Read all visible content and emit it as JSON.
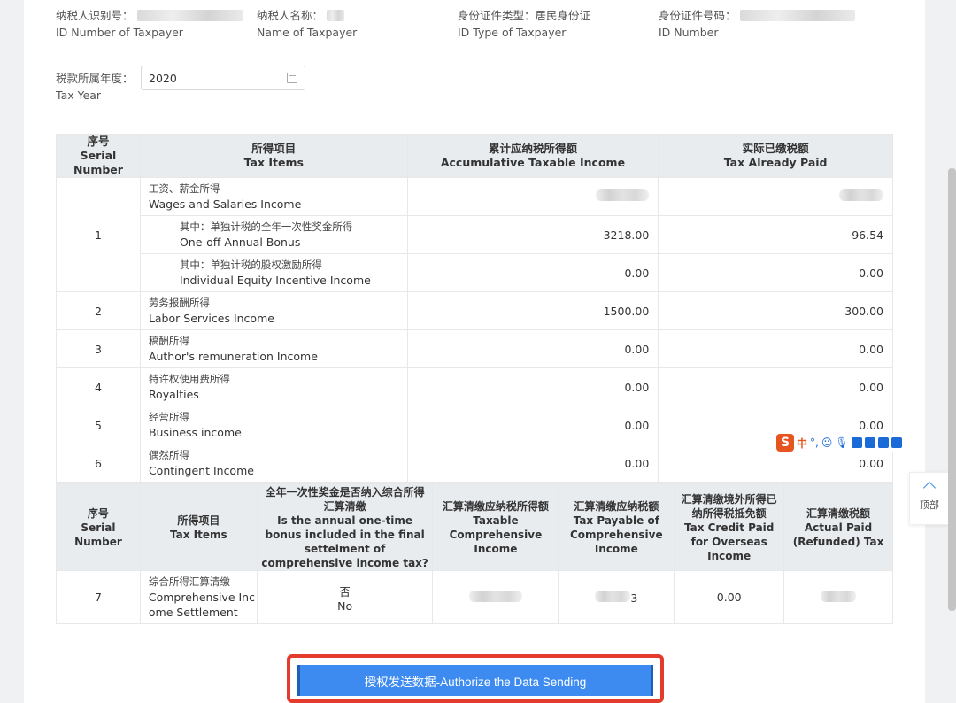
{
  "header": {
    "taxpayer_id_cn": "纳税人识别号：",
    "taxpayer_id_en": "ID Number of Taxpayer",
    "taxpayer_name_cn": "纳税人名称：",
    "taxpayer_name_en": "Name of Taxpayer",
    "id_type_cn": "身份证件类型：居民身份证",
    "id_type_en": "ID Type of Taxpayer",
    "id_number_cn": "身份证件号码：",
    "id_number_en": "ID Number"
  },
  "tax_year": {
    "label_cn": "税款所属年度：",
    "label_en": "Tax Year",
    "value": "2020"
  },
  "table1": {
    "headers": [
      {
        "cn": "序号",
        "en": "Serial Number"
      },
      {
        "cn": "所得项目",
        "en": "Tax Items"
      },
      {
        "cn": "累计应纳税所得额",
        "en": "Accumulative Taxable Income"
      },
      {
        "cn": "实际已缴税额",
        "en": "Tax Already Paid"
      }
    ],
    "rows": [
      {
        "no": "1",
        "cn": "工资、薪金所得",
        "en": "Wages and Salaries Income",
        "income": "",
        "paid": ""
      },
      {
        "cn": "其中：单独计税的全年一次性奖金所得",
        "en": "One-off Annual Bonus",
        "income": "3218.00",
        "paid": "96.54"
      },
      {
        "cn": "其中：单独计税的股权激励所得",
        "en": "Individual Equity Incentive Income",
        "income": "0.00",
        "paid": "0.00"
      },
      {
        "no": "2",
        "cn": "劳务报酬所得",
        "en": "Labor Services Income",
        "income": "1500.00",
        "paid": "300.00"
      },
      {
        "no": "3",
        "cn": "稿酬所得",
        "en": "Author's remuneration Income",
        "income": "0.00",
        "paid": "0.00"
      },
      {
        "no": "4",
        "cn": "特许权使用费所得",
        "en": "Royalties",
        "income": "0.00",
        "paid": "0.00"
      },
      {
        "no": "5",
        "cn": "经营所得",
        "en": "Business income",
        "income": "0.00",
        "paid": "0.00"
      },
      {
        "no": "6",
        "cn": "偶然所得",
        "en": "Contingent Income",
        "income": "0.00",
        "paid": "0.00"
      }
    ]
  },
  "table2": {
    "headers": [
      {
        "cn": "序号",
        "en": "Serial Number"
      },
      {
        "cn": "所得项目",
        "en": "Tax Items"
      },
      {
        "cn": "全年一次性奖金是否纳入综合所得汇算清缴",
        "en": "Is the annual one-time bonus included in the final settelment of comprehensive income tax?"
      },
      {
        "cn": "汇算清缴应纳税所得额",
        "en": "Taxable Comprehensive Income"
      },
      {
        "cn": "汇算清缴应纳税额",
        "en": "Tax Payable of Comprehensive Income"
      },
      {
        "cn": "汇算清缴境外所得已纳所得税抵免额",
        "en": "Tax Credit Paid for Overseas Income"
      },
      {
        "cn": "汇算清缴税额",
        "en": "Actual Paid (Refunded) Tax"
      }
    ],
    "row": {
      "no": "7",
      "cn": "综合所得汇算清缴",
      "en_line1": "Comprehensive Inc",
      "en_line2": "ome Settlement",
      "included_cn": "否",
      "included_en": "No",
      "overseas_credit": "0.00",
      "tax_payable_suffix": "3"
    }
  },
  "authorize_button": "授权发送数据-Authorize the Data Sending",
  "back_to_top": "顶部",
  "ime": {
    "lang": "中"
  }
}
